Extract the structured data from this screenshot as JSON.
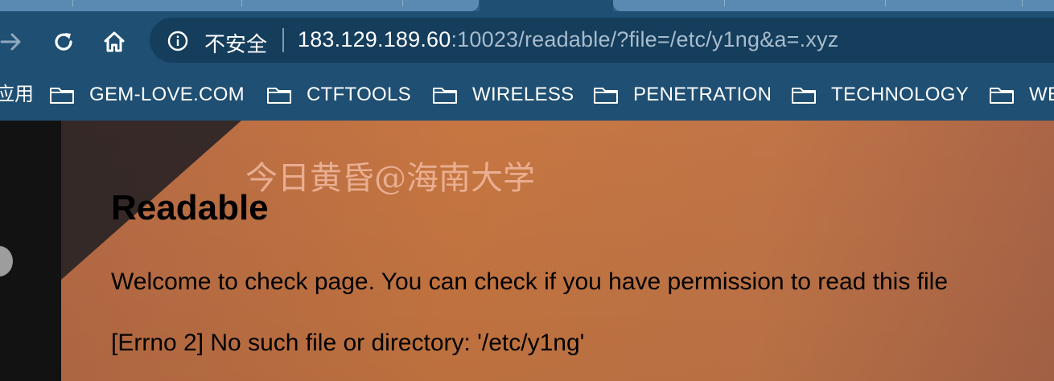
{
  "omnibox": {
    "security_label": "不安全",
    "url_host": "183.129.189.60",
    "url_rest": ":10023/readable/?file=/etc/y1ng&a=.xyz"
  },
  "bookmarks": {
    "apps_label": "应用",
    "items": [
      {
        "label": "GEM-LOVE.COM",
        "icon": "folder-icon"
      },
      {
        "label": "CTFTOOLS",
        "icon": "folder-icon"
      },
      {
        "label": "WIRELESS",
        "icon": "folder-icon"
      },
      {
        "label": "PENETRATION",
        "icon": "folder-icon"
      },
      {
        "label": "TECHNOLOGY",
        "icon": "folder-icon"
      },
      {
        "label": "WE",
        "icon": "folder-icon"
      }
    ]
  },
  "page": {
    "watermark": "今日黄昏@海南大学",
    "title": "Readable",
    "welcome": "Welcome to check page. You can check if you have permission to read this file",
    "error": "[Errno 2] No such file or directory: '/etc/y1ng'"
  },
  "icons": {
    "forward": "forward-arrow-icon",
    "reload": "reload-icon",
    "home": "home-icon",
    "info": "info-icon"
  },
  "colors": {
    "chrome_bg": "#1f4f72",
    "omnibox_bg": "#153d5c",
    "page_bg": "#c67641"
  }
}
